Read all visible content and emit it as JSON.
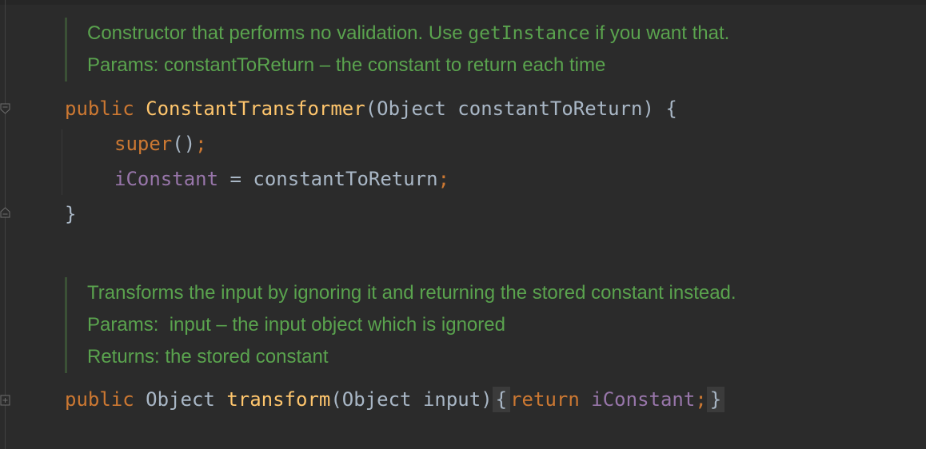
{
  "doc1": {
    "line1_pre": "Constructor that performs no validation. Use ",
    "line1_code": "getInstance",
    "line1_post": " if you want that.",
    "line2": "Params: constantToReturn – the constant to return each time"
  },
  "constructor": {
    "kw_public": "public",
    "name": "ConstantTransformer",
    "params": "(Object constantToReturn) {",
    "super_kw": "super",
    "super_parens": "()",
    "super_semi": ";",
    "field": "iConstant",
    "assign": " = constantToReturn",
    "assign_semi": ";",
    "close": "}"
  },
  "doc2": {
    "line1": "Transforms the input by ignoring it and returning the stored constant instead.",
    "line2": "Params:  input – the input object which is ignored",
    "line3": "Returns: the stored constant"
  },
  "transform": {
    "kw_public": "public",
    "type": "Object",
    "name": "transform",
    "params": "(Object input)",
    "open_brace": "{",
    "kw_return": "return",
    "field": "iConstant",
    "semi": ";",
    "close_brace": "}"
  },
  "colors": {
    "background": "#2b2b2b",
    "keyword": "#cc7832",
    "method": "#ffc66d",
    "field": "#9876aa",
    "text": "#a9b7c6",
    "doc_comment": "#5aa34e"
  },
  "icons": {
    "fold_collapse": "fold-collapse-icon",
    "fold_end": "fold-end-icon",
    "fold_expand": "fold-expand-icon"
  }
}
